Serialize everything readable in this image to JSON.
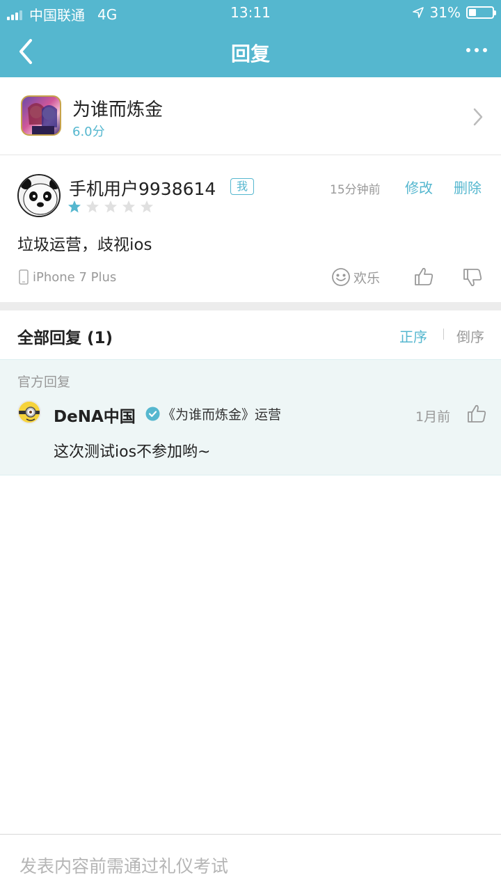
{
  "status_bar": {
    "carrier": "中国联通",
    "network": "4G",
    "time": "13:11",
    "battery": "31%",
    "battery_level": 0.31
  },
  "nav": {
    "title": "回复",
    "back_icon": "chevron-left-icon",
    "more_icon": "more-dots-icon"
  },
  "app": {
    "name": "为谁而炼金",
    "score": "6.0分"
  },
  "review": {
    "username": "手机用户9938614",
    "badge": "我",
    "time": "15分钟前",
    "edit_label": "修改",
    "delete_label": "删除",
    "rating": 1,
    "rating_max": 5,
    "text": "垃圾运营，歧视ios",
    "device": "iPhone 7 Plus",
    "mood": "欢乐"
  },
  "replies": {
    "title": "全部回复 (1)",
    "sort_asc": "正序",
    "sort_desc": "倒序",
    "official_label": "官方回复",
    "items": [
      {
        "name": "DeNA中国",
        "role": "《为谁而炼金》运营",
        "time": "1月前",
        "text": "这次测试ios不参加哟~"
      }
    ]
  },
  "composer": {
    "placeholder": "发表内容前需通过礼仪考试"
  },
  "colors": {
    "accent": "#55b7cf",
    "star_active": "#55b7cf",
    "star_inactive": "#e0e0e0",
    "official_bg": "#eef6f6"
  }
}
